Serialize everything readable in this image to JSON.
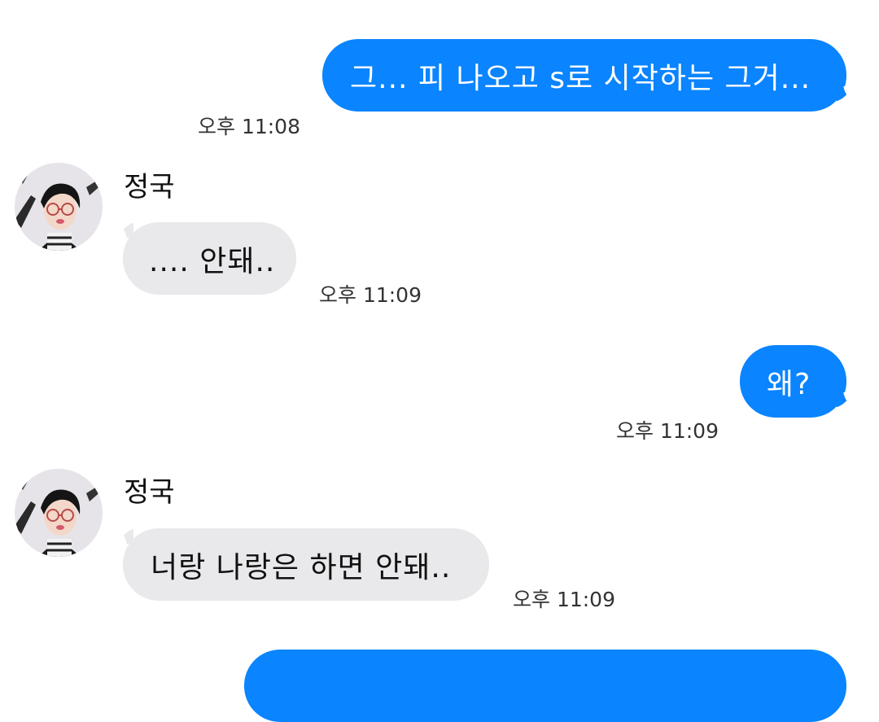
{
  "colors": {
    "outgoing_bubble": "#0a84ff",
    "incoming_bubble": "#e9e9eb",
    "background": "#ffffff"
  },
  "messages": [
    {
      "direction": "outgoing",
      "text": "그... 피 나오고 s로 시작하는 그거...",
      "time": "오후 11:08"
    },
    {
      "direction": "incoming",
      "sender": "정국",
      "text": ".... 안돼..",
      "time": "오후 11:09"
    },
    {
      "direction": "outgoing",
      "text": "왜?",
      "time": "오후 11:09"
    },
    {
      "direction": "incoming",
      "sender": "정국",
      "text": "너랑 나랑은 하면 안돼..",
      "time": "오후 11:09"
    },
    {
      "direction": "outgoing",
      "text": "",
      "time": ""
    }
  ]
}
